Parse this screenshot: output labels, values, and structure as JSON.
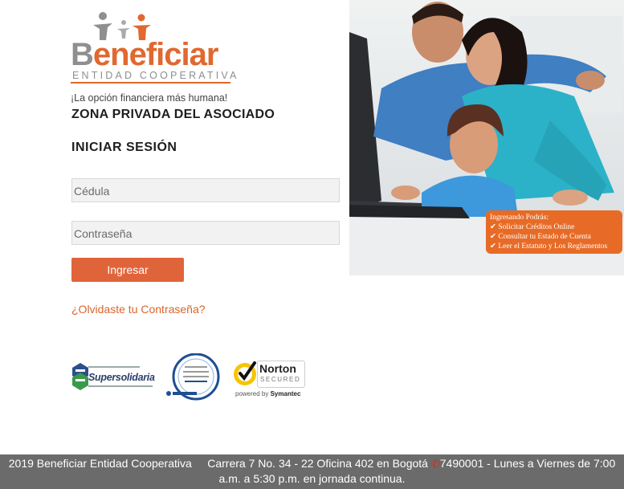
{
  "logo": {
    "brand_prefix": "B",
    "brand_rest": "eneficiar",
    "subtitle": "ENTIDAD COOPERATIVA",
    "tagline": "¡La opción financiera más humana!"
  },
  "header": {
    "zone_title": "ZONA PRIVADA DEL ASOCIADO",
    "login_title": "INICIAR SESIÓN"
  },
  "form": {
    "cedula_placeholder": "Cédula",
    "cedula_value": "",
    "password_placeholder": "Contraseña",
    "password_value": "",
    "submit_label": "Ingresar",
    "forgot_link": "¿Olvidaste tu Contraseña?"
  },
  "badges": {
    "supersolidaria": "Supersolidaria",
    "norton_name": "Norton",
    "norton_secured": "SECURED",
    "norton_powered": "powered by",
    "norton_symantec": "Symantec"
  },
  "promo": {
    "heading": "Ingresando Podrás:",
    "items": [
      "✔ Solicitar Créditos Online",
      "✔ Consultar tu Estado de Cuenta",
      "✔ Leer el Estatuto y Los Reglamentos"
    ]
  },
  "footer": {
    "copyright": "2019 Beneficiar Entidad Cooperativa",
    "address": "Carrera 7 No. 34 - 22 Oficina 402 en Bogotá",
    "phone_hours": "7490001 - Lunes a Viernes de 7:00 a.m. a 5:30 p.m. en jornada continua."
  },
  "colors": {
    "brand_orange": "#e1682f",
    "button_orange": "#e0643a",
    "footer_gray": "#6b6b6b",
    "logo_gray": "#8f8f8f"
  }
}
